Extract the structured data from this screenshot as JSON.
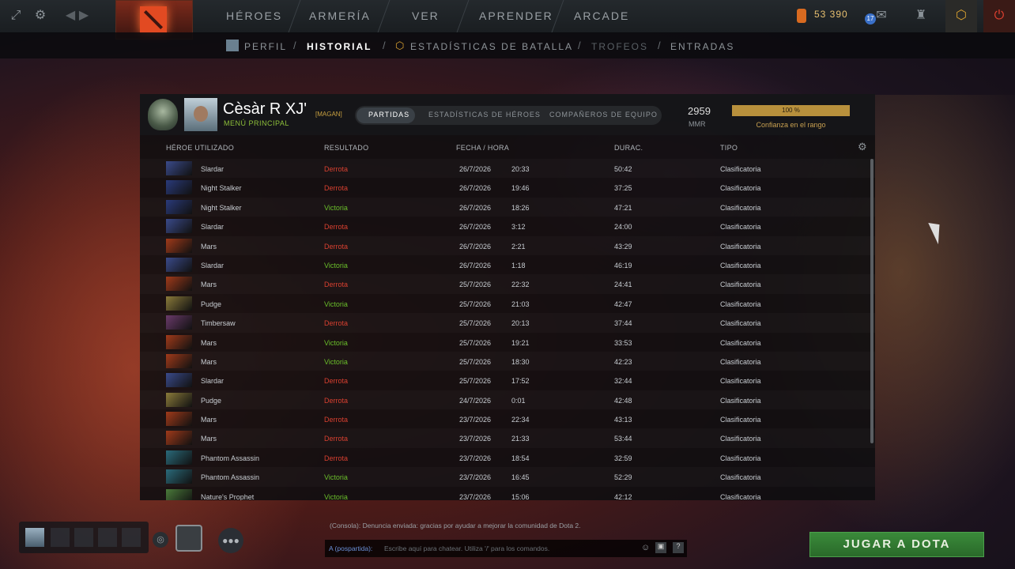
{
  "topnav": {
    "items": [
      "HÉROES",
      "ARMERÍA",
      "VER",
      "APRENDER",
      "ARCADE"
    ],
    "shards": "53 390",
    "level_badge": "17"
  },
  "subnav": {
    "items": [
      "PERFIL",
      "HISTORIAL",
      "ESTADÍSTICAS DE BATALLA",
      "TROFEOS",
      "ENTRADAS"
    ],
    "active": "HISTORIAL"
  },
  "profile": {
    "name": "Cèsàr R XJ'",
    "tag": "[MAGAN]",
    "status": "MENÚ PRINCIPAL",
    "tabs": [
      "PARTIDAS",
      "ESTADÍSTICAS DE HÉROES",
      "COMPAÑEROS DE EQUIPO"
    ],
    "mmr": "2959",
    "mmr_label": "MMR",
    "confidence_pct": "100 %",
    "confidence_value": 1.0,
    "confidence_label": "Confianza en el rango"
  },
  "table": {
    "headers": [
      "HÉROE UTILIZADO",
      "RESULTADO",
      "FECHA / HORA",
      "DURAC.",
      "TIPO"
    ],
    "rows": [
      {
        "hero": "Slardar",
        "result": "Derrota",
        "date": "26/7/2026",
        "time": "20:33",
        "dur": "50:42",
        "type": "Clasificatoria",
        "hc": "#3a4a8a"
      },
      {
        "hero": "Night Stalker",
        "result": "Derrota",
        "date": "26/7/2026",
        "time": "19:46",
        "dur": "37:25",
        "type": "Clasificatoria",
        "hc": "#2a3a7a"
      },
      {
        "hero": "Night Stalker",
        "result": "Victoria",
        "date": "26/7/2026",
        "time": "18:26",
        "dur": "47:21",
        "type": "Clasificatoria",
        "hc": "#2a3a7a"
      },
      {
        "hero": "Slardar",
        "result": "Derrota",
        "date": "26/7/2026",
        "time": "3:12",
        "dur": "24:00",
        "type": "Clasificatoria",
        "hc": "#3a4a8a"
      },
      {
        "hero": "Mars",
        "result": "Derrota",
        "date": "26/7/2026",
        "time": "2:21",
        "dur": "43:29",
        "type": "Clasificatoria",
        "hc": "#a03a1a"
      },
      {
        "hero": "Slardar",
        "result": "Victoria",
        "date": "26/7/2026",
        "time": "1:18",
        "dur": "46:19",
        "type": "Clasificatoria",
        "hc": "#3a4a8a"
      },
      {
        "hero": "Mars",
        "result": "Derrota",
        "date": "25/7/2026",
        "time": "22:32",
        "dur": "24:41",
        "type": "Clasificatoria",
        "hc": "#a03a1a"
      },
      {
        "hero": "Pudge",
        "result": "Victoria",
        "date": "25/7/2026",
        "time": "21:03",
        "dur": "42:47",
        "type": "Clasificatoria",
        "hc": "#8a7a3a"
      },
      {
        "hero": "Timbersaw",
        "result": "Derrota",
        "date": "25/7/2026",
        "time": "20:13",
        "dur": "37:44",
        "type": "Clasificatoria",
        "hc": "#6a3a6a"
      },
      {
        "hero": "Mars",
        "result": "Victoria",
        "date": "25/7/2026",
        "time": "19:21",
        "dur": "33:53",
        "type": "Clasificatoria",
        "hc": "#a03a1a"
      },
      {
        "hero": "Mars",
        "result": "Victoria",
        "date": "25/7/2026",
        "time": "18:30",
        "dur": "42:23",
        "type": "Clasificatoria",
        "hc": "#a03a1a"
      },
      {
        "hero": "Slardar",
        "result": "Derrota",
        "date": "25/7/2026",
        "time": "17:52",
        "dur": "32:44",
        "type": "Clasificatoria",
        "hc": "#3a4a8a"
      },
      {
        "hero": "Pudge",
        "result": "Derrota",
        "date": "24/7/2026",
        "time": "0:01",
        "dur": "42:48",
        "type": "Clasificatoria",
        "hc": "#8a7a3a"
      },
      {
        "hero": "Mars",
        "result": "Derrota",
        "date": "23/7/2026",
        "time": "22:34",
        "dur": "43:13",
        "type": "Clasificatoria",
        "hc": "#a03a1a"
      },
      {
        "hero": "Mars",
        "result": "Derrota",
        "date": "23/7/2026",
        "time": "21:33",
        "dur": "53:44",
        "type": "Clasificatoria",
        "hc": "#a03a1a"
      },
      {
        "hero": "Phantom Assassin",
        "result": "Derrota",
        "date": "23/7/2026",
        "time": "18:54",
        "dur": "32:59",
        "type": "Clasificatoria",
        "hc": "#2a6a7a"
      },
      {
        "hero": "Phantom Assassin",
        "result": "Victoria",
        "date": "23/7/2026",
        "time": "16:45",
        "dur": "52:29",
        "type": "Clasificatoria",
        "hc": "#2a6a7a"
      },
      {
        "hero": "Nature's Prophet",
        "result": "Victoria",
        "date": "23/7/2026",
        "time": "15:06",
        "dur": "42:12",
        "type": "Clasificatoria",
        "hc": "#4a7a3a"
      }
    ]
  },
  "chat": {
    "line1": "(Consola): Denuncia enviada: gracias por ayudar a mejorar la comunidad de Dota 2.",
    "channel": "A (pospartida):",
    "placeholder": "Escribe aquí para chatear. Utiliza '/' para los comandos."
  },
  "play_button": "JUGAR A DOTA",
  "colors": {
    "loss": "#d84030",
    "win": "#6abf2a",
    "play": "#3a8a3a",
    "gold": "#b8903c"
  }
}
